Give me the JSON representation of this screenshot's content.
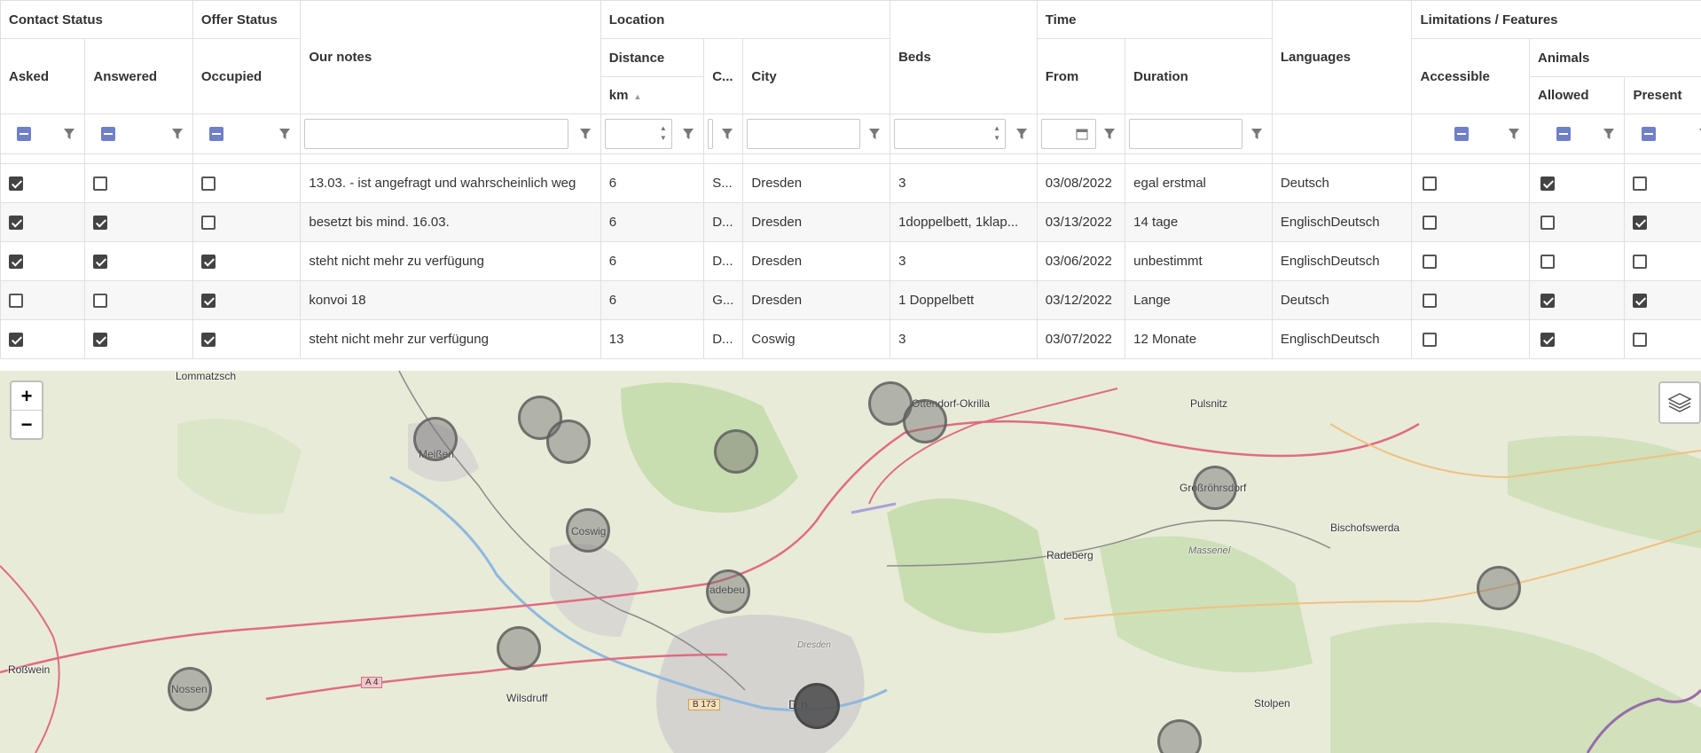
{
  "grid": {
    "groups": {
      "contact_status": "Contact Status",
      "offer_status": "Offer Status",
      "our_notes": "Our notes",
      "location": "Location",
      "beds": "Beds",
      "time": "Time",
      "languages": "Languages",
      "limitations": "Limitations / Features"
    },
    "sub": {
      "distance": "Distance",
      "animals": "Animals"
    },
    "cols": {
      "asked": "Asked",
      "answered": "Answered",
      "occupied": "Occupied",
      "km": "km",
      "country": "C...",
      "city": "City",
      "from": "From",
      "duration": "Duration",
      "accessible": "Accessible",
      "allowed": "Allowed",
      "present": "Present"
    },
    "rows": [
      {
        "asked": true,
        "answered": false,
        "occupied": false,
        "notes": "13.03. - ist angefragt und wahrscheinlich weg",
        "km": "6",
        "country": "S...",
        "city": "Dresden",
        "beds": "3",
        "from": "03/08/2022",
        "duration": "egal erstmal",
        "languages": "Deutsch",
        "accessible": false,
        "allowed": true,
        "present": false
      },
      {
        "asked": true,
        "answered": true,
        "occupied": false,
        "notes": "besetzt bis mind. 16.03.",
        "km": "6",
        "country": "D...",
        "city": "Dresden",
        "beds": "1doppelbett, 1klap...",
        "from": "03/13/2022",
        "duration": "14 tage",
        "languages": "EnglischDeutsch",
        "accessible": false,
        "allowed": false,
        "present": true
      },
      {
        "asked": true,
        "answered": true,
        "occupied": true,
        "notes": "steht nicht mehr zu verfügung",
        "km": "6",
        "country": "D...",
        "city": "Dresden",
        "beds": "3",
        "from": "03/06/2022",
        "duration": "unbestimmt",
        "languages": "EnglischDeutsch",
        "accessible": false,
        "allowed": false,
        "present": false
      },
      {
        "asked": false,
        "answered": false,
        "occupied": true,
        "notes": "konvoi 18",
        "km": "6",
        "country": "G...",
        "city": "Dresden",
        "beds": "1 Doppelbett",
        "from": "03/12/2022",
        "duration": "Lange",
        "languages": "Deutsch",
        "accessible": false,
        "allowed": true,
        "present": true
      },
      {
        "asked": true,
        "answered": true,
        "occupied": true,
        "notes": "steht nicht mehr zur verfügung",
        "km": "13",
        "country": "D...",
        "city": "Coswig",
        "beds": "3",
        "from": "03/07/2022",
        "duration": "12 Monate",
        "languages": "EnglischDeutsch",
        "accessible": false,
        "allowed": true,
        "present": false
      }
    ]
  },
  "map": {
    "zoom_in": "+",
    "zoom_out": "−",
    "places": {
      "lommatzsch": "Lommatzsch",
      "meissen": "Meißen",
      "ottendorf": "Ottendorf-Okrilla",
      "pulsnitz": "Pulsnitz",
      "grossroehrsdorf": "Großröhrsdorf",
      "coswig": "Coswig",
      "radeberg": "Radeberg",
      "bischofswerda": "Bischofswerda",
      "massenei": "Masseneí",
      "radebeul": "adebeu",
      "rosswein": "Roßwein",
      "nossen": "Nossen",
      "wilsdruff": "Wilsdruff",
      "dresden": "Dresden",
      "dresden_city": "D   n",
      "stolpen": "Stolpen",
      "a4": "A 4",
      "b173": "B 173"
    }
  }
}
